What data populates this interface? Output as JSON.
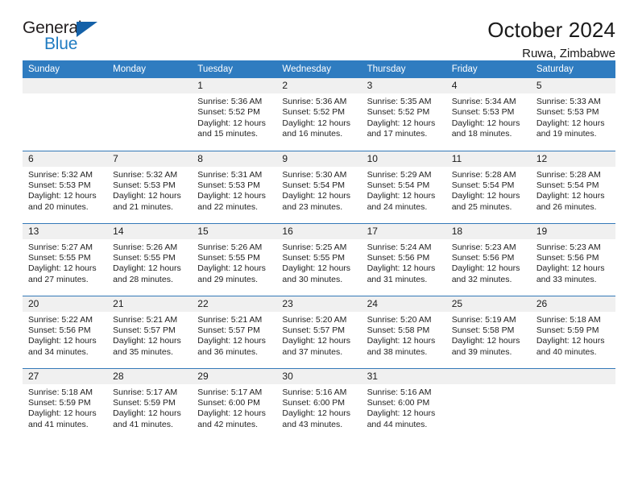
{
  "brand": {
    "name_part1": "General",
    "name_part2": "Blue",
    "triangle_color": "#1461a8",
    "blue_text_color": "#1f7bc1"
  },
  "header": {
    "month_title": "October 2024",
    "location": "Ruwa, Zimbabwe"
  },
  "theme": {
    "header_row_bg": "#2f7cc0",
    "row_divider": "#3479b8",
    "daynum_bg": "#f0f0f0",
    "page_bg": "#ffffff",
    "text": "#1a1a1a"
  },
  "calendar": {
    "weekday_headers": [
      "Sunday",
      "Monday",
      "Tuesday",
      "Wednesday",
      "Thursday",
      "Friday",
      "Saturday"
    ],
    "labels": {
      "sunrise": "Sunrise:",
      "sunset": "Sunset:",
      "daylight": "Daylight:"
    },
    "weeks": [
      [
        {
          "day": "",
          "blank": true
        },
        {
          "day": "",
          "blank": true
        },
        {
          "day": "1",
          "sunrise": "Sunrise: 5:36 AM",
          "sunset": "Sunset: 5:52 PM",
          "daylight_l1": "Daylight: 12 hours",
          "daylight_l2": "and 15 minutes."
        },
        {
          "day": "2",
          "sunrise": "Sunrise: 5:36 AM",
          "sunset": "Sunset: 5:52 PM",
          "daylight_l1": "Daylight: 12 hours",
          "daylight_l2": "and 16 minutes."
        },
        {
          "day": "3",
          "sunrise": "Sunrise: 5:35 AM",
          "sunset": "Sunset: 5:52 PM",
          "daylight_l1": "Daylight: 12 hours",
          "daylight_l2": "and 17 minutes."
        },
        {
          "day": "4",
          "sunrise": "Sunrise: 5:34 AM",
          "sunset": "Sunset: 5:53 PM",
          "daylight_l1": "Daylight: 12 hours",
          "daylight_l2": "and 18 minutes."
        },
        {
          "day": "5",
          "sunrise": "Sunrise: 5:33 AM",
          "sunset": "Sunset: 5:53 PM",
          "daylight_l1": "Daylight: 12 hours",
          "daylight_l2": "and 19 minutes."
        }
      ],
      [
        {
          "day": "6",
          "sunrise": "Sunrise: 5:32 AM",
          "sunset": "Sunset: 5:53 PM",
          "daylight_l1": "Daylight: 12 hours",
          "daylight_l2": "and 20 minutes."
        },
        {
          "day": "7",
          "sunrise": "Sunrise: 5:32 AM",
          "sunset": "Sunset: 5:53 PM",
          "daylight_l1": "Daylight: 12 hours",
          "daylight_l2": "and 21 minutes."
        },
        {
          "day": "8",
          "sunrise": "Sunrise: 5:31 AM",
          "sunset": "Sunset: 5:53 PM",
          "daylight_l1": "Daylight: 12 hours",
          "daylight_l2": "and 22 minutes."
        },
        {
          "day": "9",
          "sunrise": "Sunrise: 5:30 AM",
          "sunset": "Sunset: 5:54 PM",
          "daylight_l1": "Daylight: 12 hours",
          "daylight_l2": "and 23 minutes."
        },
        {
          "day": "10",
          "sunrise": "Sunrise: 5:29 AM",
          "sunset": "Sunset: 5:54 PM",
          "daylight_l1": "Daylight: 12 hours",
          "daylight_l2": "and 24 minutes."
        },
        {
          "day": "11",
          "sunrise": "Sunrise: 5:28 AM",
          "sunset": "Sunset: 5:54 PM",
          "daylight_l1": "Daylight: 12 hours",
          "daylight_l2": "and 25 minutes."
        },
        {
          "day": "12",
          "sunrise": "Sunrise: 5:28 AM",
          "sunset": "Sunset: 5:54 PM",
          "daylight_l1": "Daylight: 12 hours",
          "daylight_l2": "and 26 minutes."
        }
      ],
      [
        {
          "day": "13",
          "sunrise": "Sunrise: 5:27 AM",
          "sunset": "Sunset: 5:55 PM",
          "daylight_l1": "Daylight: 12 hours",
          "daylight_l2": "and 27 minutes."
        },
        {
          "day": "14",
          "sunrise": "Sunrise: 5:26 AM",
          "sunset": "Sunset: 5:55 PM",
          "daylight_l1": "Daylight: 12 hours",
          "daylight_l2": "and 28 minutes."
        },
        {
          "day": "15",
          "sunrise": "Sunrise: 5:26 AM",
          "sunset": "Sunset: 5:55 PM",
          "daylight_l1": "Daylight: 12 hours",
          "daylight_l2": "and 29 minutes."
        },
        {
          "day": "16",
          "sunrise": "Sunrise: 5:25 AM",
          "sunset": "Sunset: 5:55 PM",
          "daylight_l1": "Daylight: 12 hours",
          "daylight_l2": "and 30 minutes."
        },
        {
          "day": "17",
          "sunrise": "Sunrise: 5:24 AM",
          "sunset": "Sunset: 5:56 PM",
          "daylight_l1": "Daylight: 12 hours",
          "daylight_l2": "and 31 minutes."
        },
        {
          "day": "18",
          "sunrise": "Sunrise: 5:23 AM",
          "sunset": "Sunset: 5:56 PM",
          "daylight_l1": "Daylight: 12 hours",
          "daylight_l2": "and 32 minutes."
        },
        {
          "day": "19",
          "sunrise": "Sunrise: 5:23 AM",
          "sunset": "Sunset: 5:56 PM",
          "daylight_l1": "Daylight: 12 hours",
          "daylight_l2": "and 33 minutes."
        }
      ],
      [
        {
          "day": "20",
          "sunrise": "Sunrise: 5:22 AM",
          "sunset": "Sunset: 5:56 PM",
          "daylight_l1": "Daylight: 12 hours",
          "daylight_l2": "and 34 minutes."
        },
        {
          "day": "21",
          "sunrise": "Sunrise: 5:21 AM",
          "sunset": "Sunset: 5:57 PM",
          "daylight_l1": "Daylight: 12 hours",
          "daylight_l2": "and 35 minutes."
        },
        {
          "day": "22",
          "sunrise": "Sunrise: 5:21 AM",
          "sunset": "Sunset: 5:57 PM",
          "daylight_l1": "Daylight: 12 hours",
          "daylight_l2": "and 36 minutes."
        },
        {
          "day": "23",
          "sunrise": "Sunrise: 5:20 AM",
          "sunset": "Sunset: 5:57 PM",
          "daylight_l1": "Daylight: 12 hours",
          "daylight_l2": "and 37 minutes."
        },
        {
          "day": "24",
          "sunrise": "Sunrise: 5:20 AM",
          "sunset": "Sunset: 5:58 PM",
          "daylight_l1": "Daylight: 12 hours",
          "daylight_l2": "and 38 minutes."
        },
        {
          "day": "25",
          "sunrise": "Sunrise: 5:19 AM",
          "sunset": "Sunset: 5:58 PM",
          "daylight_l1": "Daylight: 12 hours",
          "daylight_l2": "and 39 minutes."
        },
        {
          "day": "26",
          "sunrise": "Sunrise: 5:18 AM",
          "sunset": "Sunset: 5:59 PM",
          "daylight_l1": "Daylight: 12 hours",
          "daylight_l2": "and 40 minutes."
        }
      ],
      [
        {
          "day": "27",
          "sunrise": "Sunrise: 5:18 AM",
          "sunset": "Sunset: 5:59 PM",
          "daylight_l1": "Daylight: 12 hours",
          "daylight_l2": "and 41 minutes."
        },
        {
          "day": "28",
          "sunrise": "Sunrise: 5:17 AM",
          "sunset": "Sunset: 5:59 PM",
          "daylight_l1": "Daylight: 12 hours",
          "daylight_l2": "and 41 minutes."
        },
        {
          "day": "29",
          "sunrise": "Sunrise: 5:17 AM",
          "sunset": "Sunset: 6:00 PM",
          "daylight_l1": "Daylight: 12 hours",
          "daylight_l2": "and 42 minutes."
        },
        {
          "day": "30",
          "sunrise": "Sunrise: 5:16 AM",
          "sunset": "Sunset: 6:00 PM",
          "daylight_l1": "Daylight: 12 hours",
          "daylight_l2": "and 43 minutes."
        },
        {
          "day": "31",
          "sunrise": "Sunrise: 5:16 AM",
          "sunset": "Sunset: 6:00 PM",
          "daylight_l1": "Daylight: 12 hours",
          "daylight_l2": "and 44 minutes."
        },
        {
          "day": "",
          "blank": true
        },
        {
          "day": "",
          "blank": true
        }
      ]
    ]
  }
}
